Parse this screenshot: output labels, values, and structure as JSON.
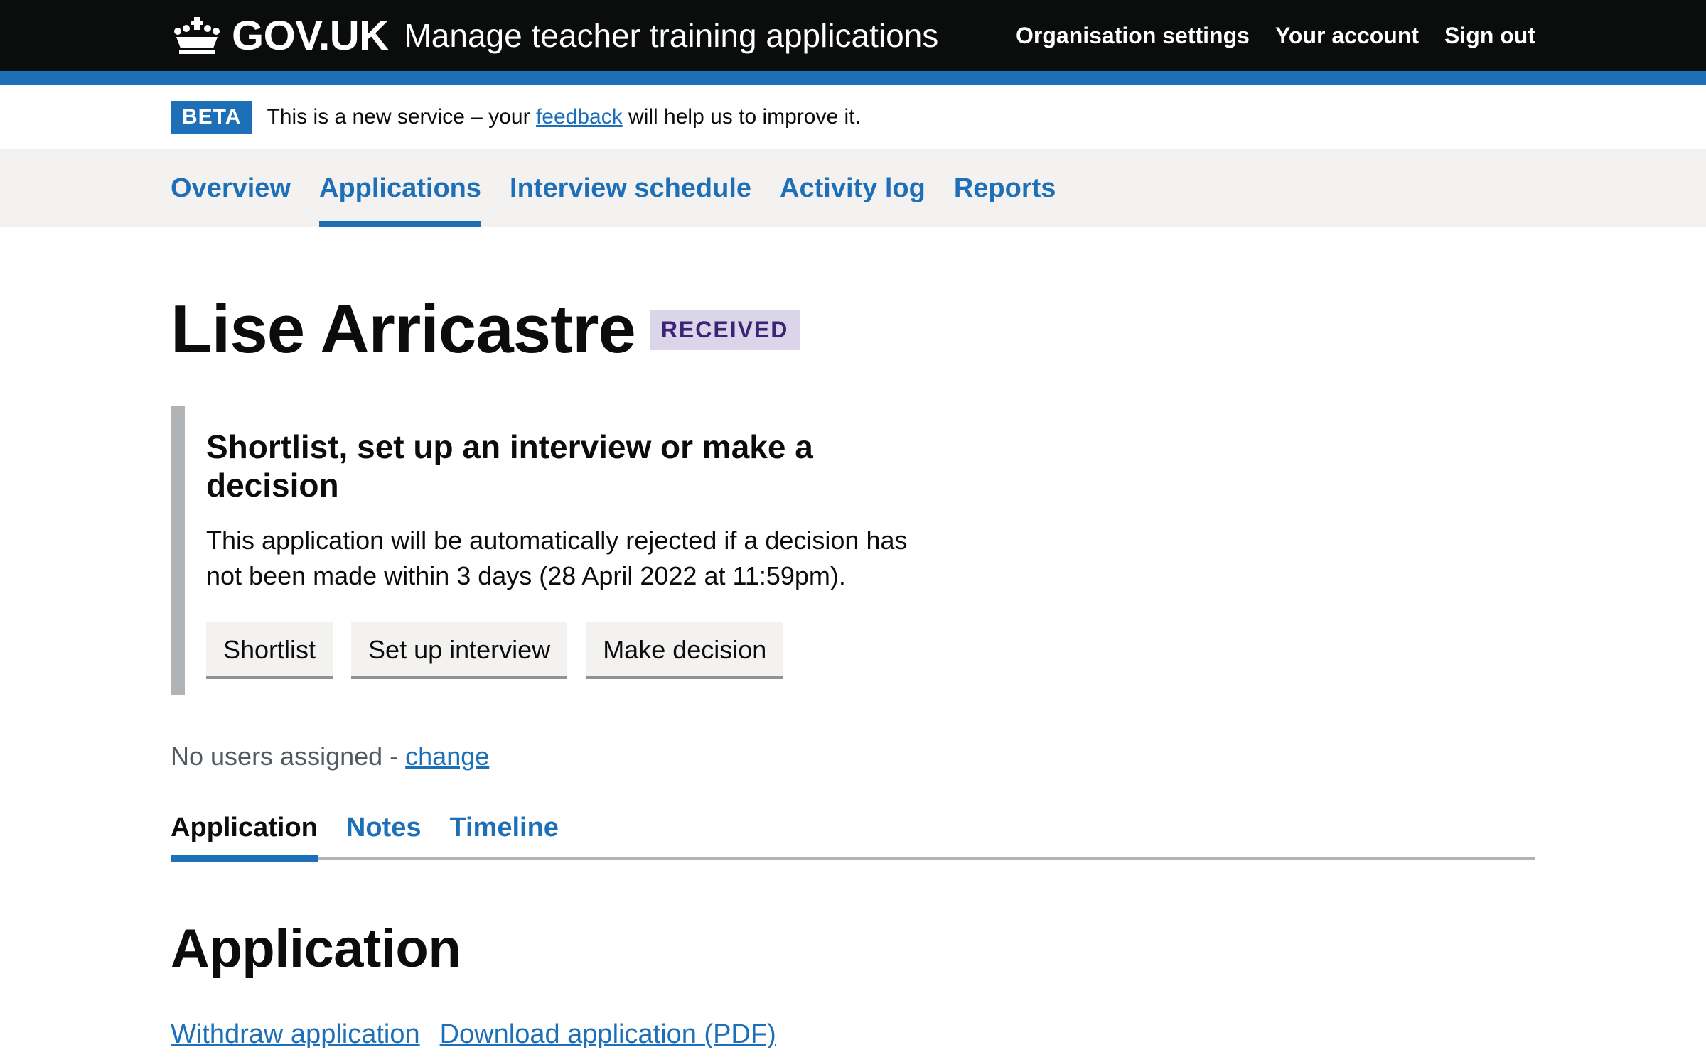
{
  "header": {
    "logo_text": "GOV.UK",
    "service_name": "Manage teacher training applications",
    "nav": [
      "Organisation settings",
      "Your account",
      "Sign out"
    ]
  },
  "phase_banner": {
    "tag": "BETA",
    "text_before": "This is a new service – your ",
    "link": "feedback",
    "text_after": " will help us to improve it."
  },
  "primary_nav": {
    "items": [
      "Overview",
      "Applications",
      "Interview schedule",
      "Activity log",
      "Reports"
    ],
    "current": "Applications"
  },
  "page": {
    "title": "Lise Arricastre",
    "status": "RECEIVED"
  },
  "inset": {
    "heading": "Shortlist, set up an interview or make a decision",
    "body": "This application will be automatically rejected if a decision has not been made within 3 days (28 April 2022 at 11:59pm).",
    "buttons": [
      "Shortlist",
      "Set up interview",
      "Make decision"
    ]
  },
  "assignment": {
    "text": "No users assigned - ",
    "link": "change"
  },
  "tabs": {
    "items": [
      "Application",
      "Notes",
      "Timeline"
    ],
    "selected": "Application"
  },
  "section": {
    "title": "Application",
    "links": [
      "Withdraw application",
      "Download application (PDF)"
    ]
  },
  "colors": {
    "header_bg": "#0b0c0c",
    "brand_blue": "#1d70b8",
    "nav_bg": "#f3f2f1",
    "status_tag_bg": "#dbd5e9",
    "status_tag_text": "#3d2375",
    "inset_border": "#b1b4b6"
  }
}
